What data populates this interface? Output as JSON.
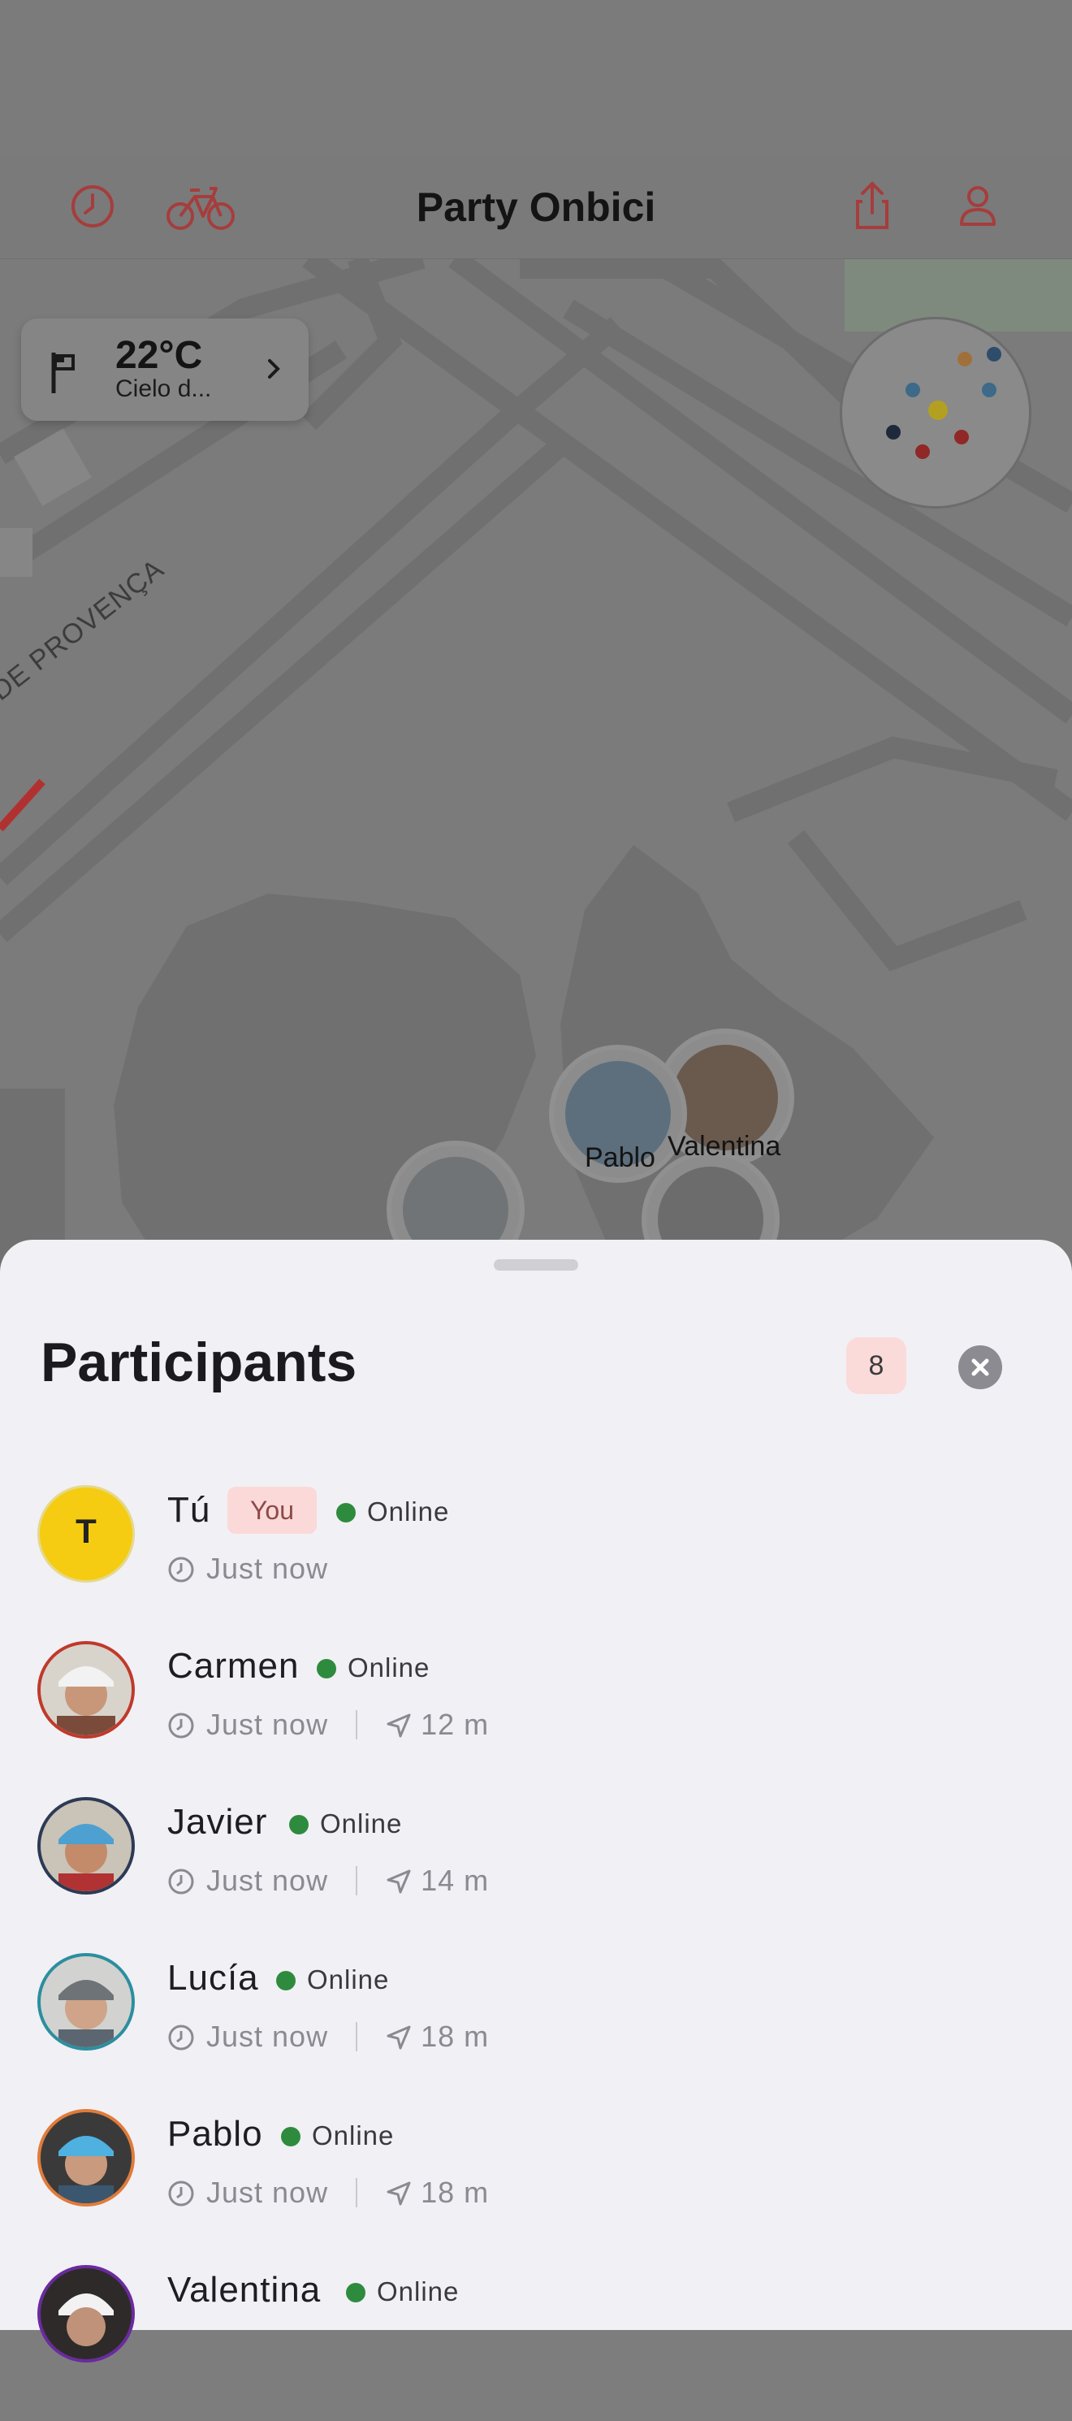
{
  "header": {
    "title": "Party Onbici",
    "history_icon": "clock-icon",
    "bike_icon": "bicycle-icon",
    "share_icon": "share-icon",
    "profile_icon": "user-icon"
  },
  "weather": {
    "temperature": "22°C",
    "description": "Cielo d...",
    "flag_icon": "flag-icon",
    "chevron_icon": "chevron-right-icon"
  },
  "map": {
    "street_label": "DE PROVENÇA",
    "marker_labels": [
      "Pablo",
      "Valentina"
    ]
  },
  "colors": {
    "accent": "#c0392b",
    "online": "#2e8b3e",
    "you_badge_bg": "#fbd9d8",
    "you_avatar": "#f5cc11"
  },
  "sheet": {
    "title": "Participants",
    "count": "8",
    "close_icon": "close-icon",
    "participants": [
      {
        "name": "Tú",
        "badge": "You",
        "initial": "T",
        "status": "Online",
        "last_seen": "Just now",
        "distance": ""
      },
      {
        "name": "Carmen",
        "status": "Online",
        "last_seen": "Just now",
        "distance": "12 m"
      },
      {
        "name": "Javier",
        "status": "Online",
        "last_seen": "Just now",
        "distance": "14 m"
      },
      {
        "name": "Lucía",
        "status": "Online",
        "last_seen": "Just now",
        "distance": "18 m"
      },
      {
        "name": "Pablo",
        "status": "Online",
        "last_seen": "Just now",
        "distance": "18 m"
      },
      {
        "name": "Valentina",
        "status": "Online",
        "last_seen": "",
        "distance": ""
      }
    ]
  }
}
